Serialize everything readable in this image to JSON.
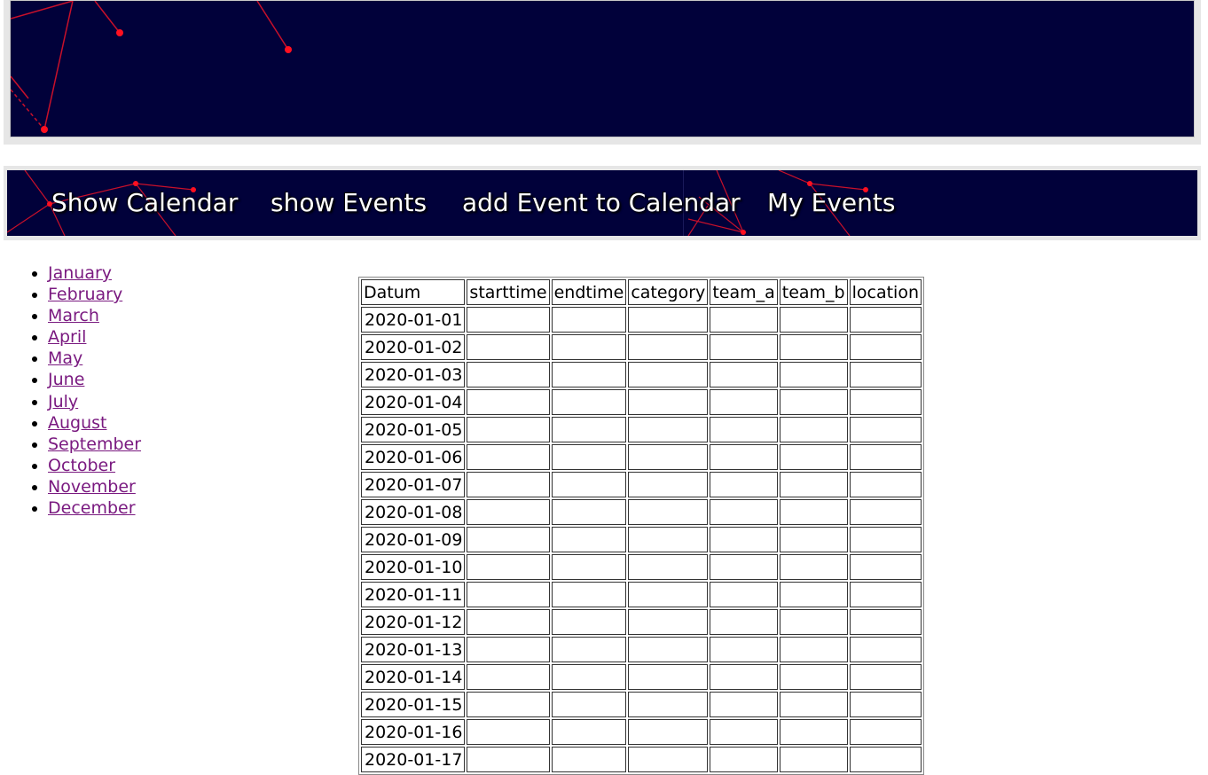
{
  "nav": {
    "items": [
      {
        "label": "Show Calendar"
      },
      {
        "label": "show Events"
      },
      {
        "label": "add Event to Calendar"
      },
      {
        "label": "My Events"
      }
    ]
  },
  "months": [
    "January",
    "February",
    "March",
    "April",
    "May",
    "June",
    "July",
    "August",
    "September",
    "October",
    "November",
    "December"
  ],
  "table": {
    "headers": [
      "Datum",
      "starttime",
      "endtime",
      "category",
      "team_a",
      "team_b",
      "location"
    ],
    "dates": [
      "2020-01-01",
      "2020-01-02",
      "2020-01-03",
      "2020-01-04",
      "2020-01-05",
      "2020-01-06",
      "2020-01-07",
      "2020-01-08",
      "2020-01-09",
      "2020-01-10",
      "2020-01-11",
      "2020-01-12",
      "2020-01-13",
      "2020-01-14",
      "2020-01-15",
      "2020-01-16",
      "2020-01-17"
    ]
  },
  "colors": {
    "banner_bg": "#01013a",
    "accent_red": "#e0102a",
    "link_visited": "#7a1a80"
  }
}
